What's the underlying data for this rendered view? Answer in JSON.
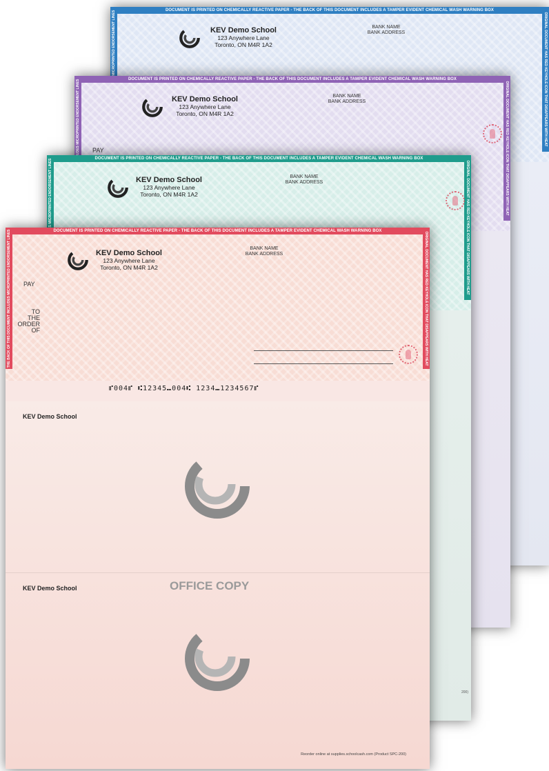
{
  "colors": {
    "blue": "#2f7fc2",
    "purple": "#8f63b5",
    "teal": "#1f9c8c",
    "red": "#e24b5e",
    "seal": "#e2465a"
  },
  "school": {
    "name": "KEV Demo School",
    "address_line1": "123 Anywhere Lane",
    "address_line2": "Toronto, ON M4R 1A2"
  },
  "bank": {
    "name": "BANK NAME",
    "address": "BANK ADDRESS"
  },
  "banner_text": "DOCUMENT IS PRINTED ON CHEMICALLY REACTIVE PAPER - THE BACK OF THIS DOCUMENT INCLUDES A TAMPER EVIDENT CHEMICAL WASH WARNING BOX",
  "left_border_text": "THE BACK OF THIS DOCUMENT INCLUDES MICROPRINTED ENDORSEMENT LINES",
  "right_border_text": "ORIGINAL DOCUMENT HAS RED KEYHOLE ICON THAT DISAPPEARS WITH HEAT",
  "cheque": {
    "pay_label": "PAY",
    "to_label": "TO",
    "the_label": "THE",
    "order_label": "ORDER",
    "of_label": "OF",
    "micr_line": "⑈004⑈ ⑆12345⑉004⑆ 1234⑉1234567⑈"
  },
  "stub": {
    "title": "KEV Demo School",
    "office_copy": "OFFICE COPY"
  },
  "footer": {
    "reorder": "Reorder online at supplies.schoolcash.com (Product SPC-200)",
    "edge_ref": "200)"
  },
  "icons": [
    "school-logo-icon",
    "keyhole-seal-icon"
  ]
}
